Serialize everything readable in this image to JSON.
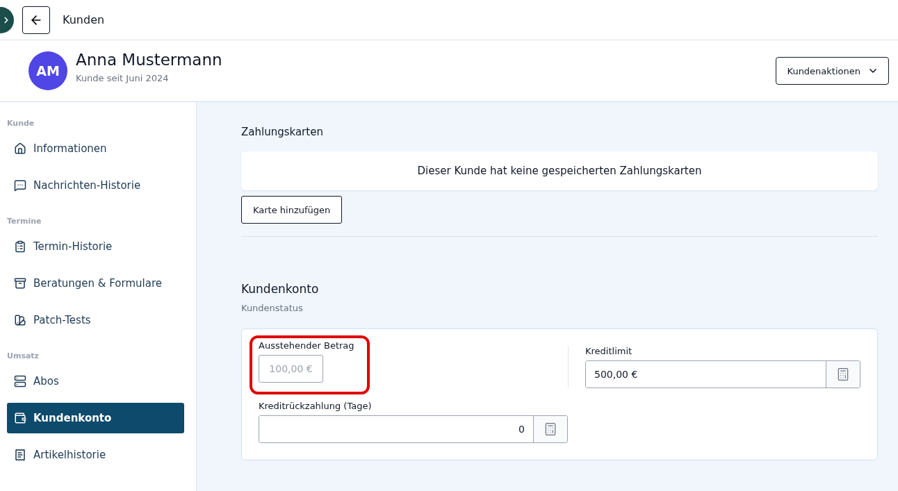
{
  "top_bar": {
    "title": "Kunden"
  },
  "customer": {
    "initials": "AM",
    "name": "Anna Mustermann",
    "since": "Kunde seit Juni 2024",
    "actions_button": "Kundenaktionen"
  },
  "sidebar": {
    "sections": [
      {
        "label": "Kunde",
        "items": [
          {
            "label": "Informationen",
            "selected": false
          },
          {
            "label": "Nachrichten-Historie",
            "selected": false
          }
        ]
      },
      {
        "label": "Termine",
        "items": [
          {
            "label": "Termin-Historie",
            "selected": false
          },
          {
            "label": "Beratungen & Formulare",
            "selected": false
          },
          {
            "label": "Patch-Tests",
            "selected": false
          }
        ]
      },
      {
        "label": "Umsatz",
        "items": [
          {
            "label": "Abos",
            "selected": false
          },
          {
            "label": "Kundenkonto",
            "selected": true
          },
          {
            "label": "Artikelhistorie",
            "selected": false
          }
        ]
      }
    ]
  },
  "payment_cards": {
    "title": "Zahlungskarten",
    "empty_message": "Dieser Kunde hat keine gespeicherten Zahlungskarten",
    "add_button": "Karte hinzufügen"
  },
  "account": {
    "title": "Kundenkonto",
    "subtitle": "Kundenstatus",
    "fields": [
      {
        "kind": "readonly",
        "label": "Ausstehender Betrag",
        "value": "100,00 €",
        "highlighted": true
      },
      {
        "kind": "currency",
        "label": "Kreditlimit",
        "value": "500,00 €",
        "highlighted": false
      },
      {
        "kind": "days",
        "label": "Kreditrückzahlung (Tage)",
        "value": "0",
        "highlighted": false
      }
    ]
  }
}
